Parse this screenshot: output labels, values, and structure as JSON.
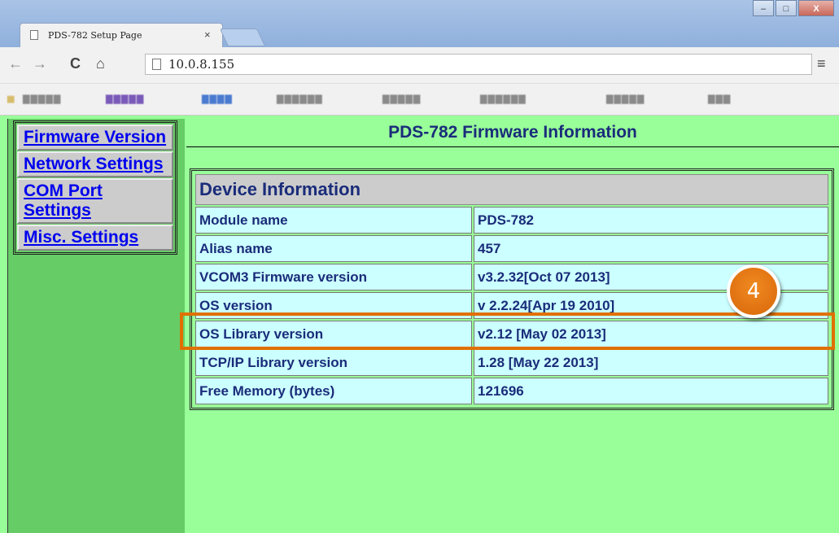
{
  "browser": {
    "tab_title": "PDS-782 Setup Page",
    "tab_close": "×",
    "url": "10.0.8.155",
    "back": "←",
    "forward": "→",
    "reload": "C",
    "home": "⌂",
    "menu": "≡",
    "window_buttons": [
      "–",
      "□",
      "X"
    ]
  },
  "sidebar": {
    "items": [
      {
        "label": "Firmware Version"
      },
      {
        "label": "Network Settings"
      },
      {
        "label": "COM Port Settings"
      },
      {
        "label": "Misc. Settings"
      }
    ]
  },
  "main": {
    "title": "PDS-782 Firmware Information",
    "device_table": {
      "header": "Device Information",
      "rows": [
        {
          "label": "Module name",
          "value": "PDS-782"
        },
        {
          "label": "Alias name",
          "value": "457"
        },
        {
          "label": "VCOM3 Firmware version",
          "value": "v3.2.32[Oct 07 2013]"
        },
        {
          "label": "OS version",
          "value": "v 2.2.24[Apr 19 2010]"
        },
        {
          "label": "OS Library version",
          "value": "v2.12 [May 02 2013]"
        },
        {
          "label": "TCP/IP Library version",
          "value": "1.28 [May 22 2013]"
        },
        {
          "label": "Free Memory (bytes)",
          "value": "121696"
        }
      ]
    }
  },
  "annotation": {
    "badge_number": "4",
    "badge_color": "#e07000"
  }
}
